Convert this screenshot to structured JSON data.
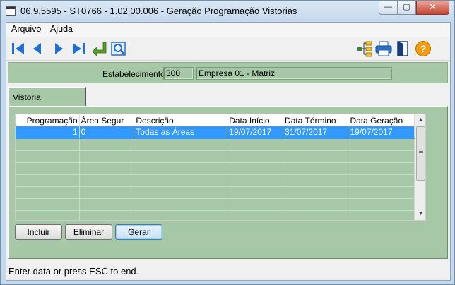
{
  "window": {
    "title": "06.9.5595 - ST0766 - 1.02.00.006 - Geração Programação Vistorias",
    "close_glyph": "✕",
    "minimize_glyph": "—",
    "maximize_glyph": "▢"
  },
  "menu": {
    "items": [
      {
        "label": "Arquivo"
      },
      {
        "label": "Ajuda"
      }
    ]
  },
  "toolbar": {
    "icons": [
      "first-record-icon",
      "previous-record-icon",
      "next-record-icon",
      "last-record-icon",
      "return-icon",
      "search-icon",
      "hierarchy-icon",
      "print-icon",
      "exit-door-icon",
      "help-icon"
    ],
    "help_glyph": "?"
  },
  "establishment": {
    "label": "Estabelecimento:",
    "code": "300",
    "name": "Empresa 01 - Matriz"
  },
  "tab": {
    "label": "Vistoria"
  },
  "grid": {
    "columns": [
      "Programação",
      "Área Segur",
      "Descrição",
      "Data Início",
      "Data Término",
      "Data Geração"
    ],
    "rows": [
      {
        "programacao": "1",
        "area": "0",
        "descricao": "Todas as Áreas",
        "data_inicio": "19/07/2017",
        "data_termino": "31/07/2017",
        "data_geracao": "19/07/2017",
        "selected": true
      }
    ]
  },
  "buttons": {
    "incluir": {
      "first": "I",
      "rest": "ncluir"
    },
    "eliminar": {
      "first": "E",
      "rest": "liminar"
    },
    "gerar": {
      "first": "G",
      "rest": "erar"
    }
  },
  "status": {
    "text": "Enter data or press ESC to end."
  },
  "colors": {
    "panel_green": "#a6c8a6",
    "selection_blue": "#3399ff",
    "toolbar_blue": "#1f6fd6"
  }
}
